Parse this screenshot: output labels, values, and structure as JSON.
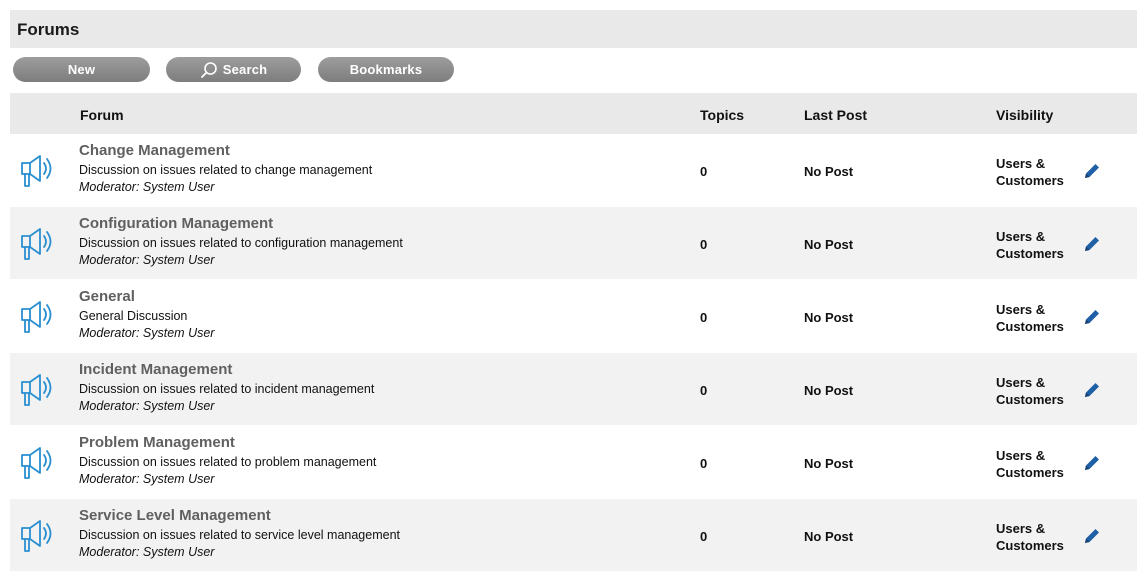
{
  "page": {
    "title": "Forums"
  },
  "toolbar": {
    "new_label": "New",
    "search_label": "Search",
    "bookmarks_label": "Bookmarks"
  },
  "table": {
    "headers": {
      "forum": "Forum",
      "topics": "Topics",
      "last_post": "Last Post",
      "visibility": "Visibility"
    },
    "rows": [
      {
        "name": "Change Management",
        "description": "Discussion on issues related to change management",
        "moderator": "Moderator: System User",
        "topics": "0",
        "last_post": "No Post",
        "visibility_line1": "Users &",
        "visibility_line2": "Customers"
      },
      {
        "name": "Configuration Management",
        "description": "Discussion on issues related to configuration management",
        "moderator": "Moderator: System User",
        "topics": "0",
        "last_post": "No Post",
        "visibility_line1": "Users &",
        "visibility_line2": "Customers"
      },
      {
        "name": "General",
        "description": "General Discussion",
        "moderator": "Moderator: System User",
        "topics": "0",
        "last_post": "No Post",
        "visibility_line1": "Users &",
        "visibility_line2": "Customers"
      },
      {
        "name": "Incident Management",
        "description": "Discussion on issues related to incident management",
        "moderator": "Moderator: System User",
        "topics": "0",
        "last_post": "No Post",
        "visibility_line1": "Users &",
        "visibility_line2": "Customers"
      },
      {
        "name": "Problem Management",
        "description": "Discussion on issues related to problem management",
        "moderator": "Moderator: System User",
        "topics": "0",
        "last_post": "No Post",
        "visibility_line1": "Users &",
        "visibility_line2": "Customers"
      },
      {
        "name": "Service Level Management",
        "description": "Discussion on issues related to service level management",
        "moderator": "Moderator: System User",
        "topics": "0",
        "last_post": "No Post",
        "visibility_line1": "Users &",
        "visibility_line2": "Customers"
      }
    ]
  },
  "icons": {
    "forum": "megaphone-icon",
    "edit": "pencil-icon",
    "search": "search-icon"
  },
  "colors": {
    "icon_blue": "#2a8fd0",
    "button_gray": "#8a8a8a",
    "header_bg": "#e9e9e9",
    "forum_name": "#606060"
  }
}
